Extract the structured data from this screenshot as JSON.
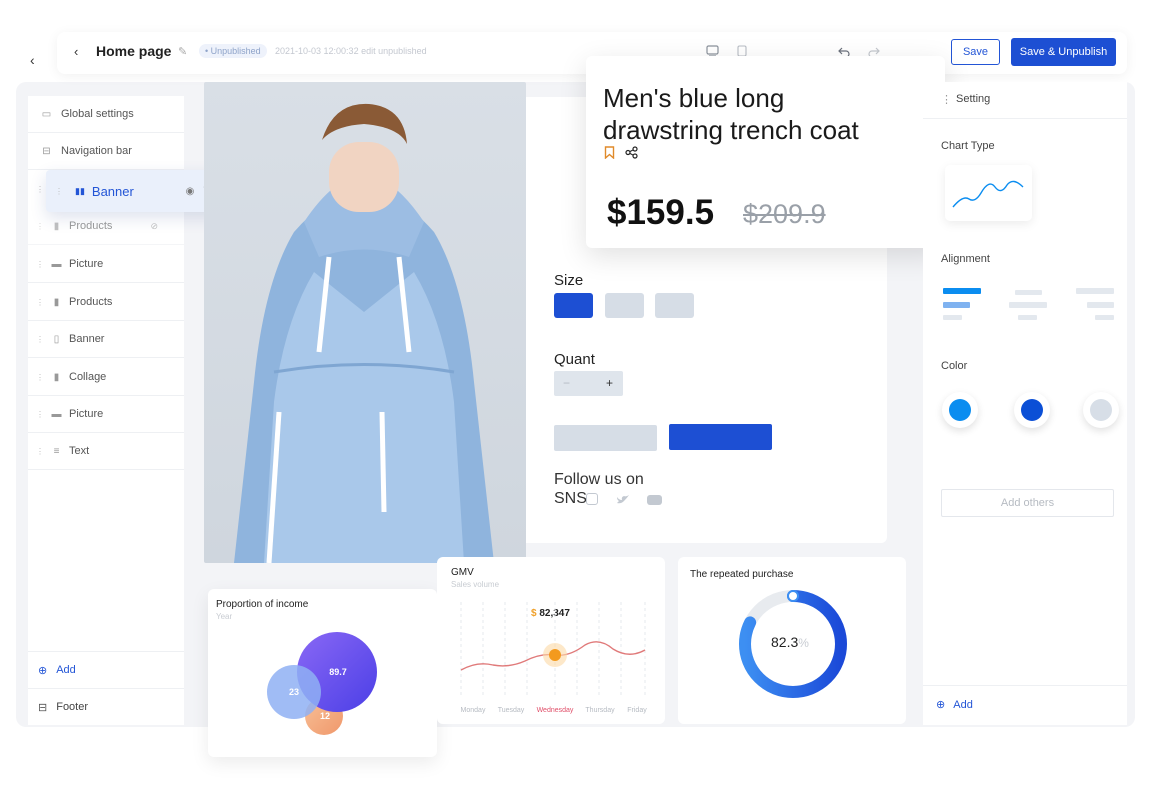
{
  "header": {
    "back_glyph": "‹",
    "title": "Home page",
    "status_badge": "• Unpublished",
    "status_text": "2021-10-03 12:00:32 edit unpublished",
    "save_label": "Save",
    "publish_label": "Save & Unpublish"
  },
  "sidebar": {
    "global_settings": "Global settings",
    "navigation_bar": "Navigation bar",
    "dragging_item": "Banner",
    "items": [
      {
        "label": "Products",
        "icon": "products-icon"
      },
      {
        "label": "Picture",
        "icon": "picture-icon"
      },
      {
        "label": "Products",
        "icon": "products-icon"
      },
      {
        "label": "Banner",
        "icon": "banner-icon"
      },
      {
        "label": "Collage",
        "icon": "collage-icon"
      },
      {
        "label": "Picture",
        "icon": "picture-icon"
      },
      {
        "label": "Text",
        "icon": "text-icon"
      }
    ],
    "add_label": "Add",
    "footer_label": "Footer"
  },
  "product": {
    "title_line1": "Men's blue long",
    "title_line2": "drawstring trench coat",
    "price": "$159.5",
    "old_price": "$209.9",
    "size_label": "Size",
    "quant_label": "Quant",
    "quant_minus": "−",
    "quant_plus": "+",
    "follow_line1": "Follow us on",
    "follow_line2": "SNS",
    "bookmark_color": "#e08a2a"
  },
  "settings": {
    "title": "Setting",
    "chart_type_label": "Chart Type",
    "alignment_label": "Alignment",
    "color_label": "Color",
    "colors": [
      "#0b8df0",
      "#0b4fd6",
      "#d7dee7"
    ],
    "add_others": "Add others",
    "add_label": "Add"
  },
  "cards": {
    "income": {
      "title": "Proportion of income",
      "subtitle": "Year"
    },
    "gmv": {
      "title": "GMV",
      "subtitle": "Sales volume",
      "value": "82,347",
      "currency": "$"
    },
    "repeat": {
      "title": "The repeated purchase",
      "value": "82.3",
      "unit": "%"
    }
  },
  "chart_data": [
    {
      "type": "bubble",
      "title": "Proportion of income",
      "subtitle": "Year",
      "values": [
        89.7,
        23,
        12
      ],
      "colors": [
        "#6a4ff0",
        "#8fb0f3",
        "#f0a06e"
      ]
    },
    {
      "type": "line",
      "title": "GMV",
      "subtitle": "Sales volume",
      "categories": [
        "Monday",
        "Tuesday",
        "Wednesday",
        "Thursday",
        "Friday"
      ],
      "highlight": {
        "category": "Wednesday",
        "label": "$ 82,347"
      },
      "line_color": "#e07a7a"
    },
    {
      "type": "donut",
      "title": "The repeated purchase",
      "value": 82.3,
      "unit": "%",
      "color": "#1f5fe0"
    }
  ]
}
